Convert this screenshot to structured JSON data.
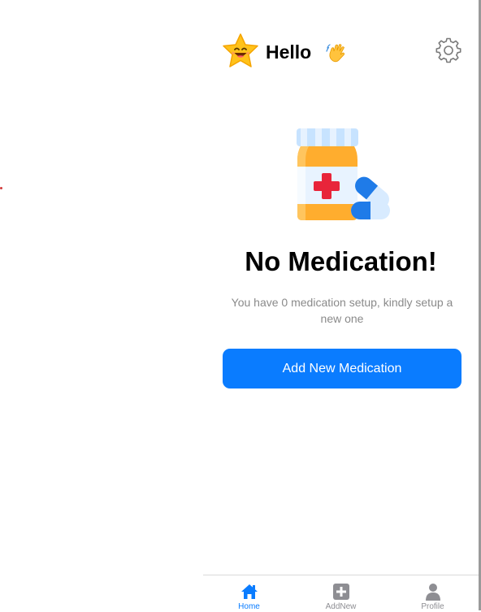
{
  "header": {
    "greeting": "Hello",
    "avatar_icon": "smiling-star-icon",
    "wave_icon": "waving-hand-icon",
    "settings_icon": "gear-icon"
  },
  "empty_state": {
    "illustration_icon": "medicine-bottle-icon",
    "title": "No Medication!",
    "subtitle": "You have 0 medication setup, kindly setup a new one",
    "button_label": "Add New Medication"
  },
  "tabbar": {
    "tabs": [
      {
        "label": "Home",
        "icon": "home-icon",
        "active": true
      },
      {
        "label": "AddNew",
        "icon": "plus-square-icon",
        "active": false
      },
      {
        "label": "Profile",
        "icon": "user-icon",
        "active": false
      }
    ]
  },
  "colors": {
    "primary": "#0a7cff",
    "inactive_tab": "#8e8e93",
    "subtitle": "#8a8a8a"
  }
}
